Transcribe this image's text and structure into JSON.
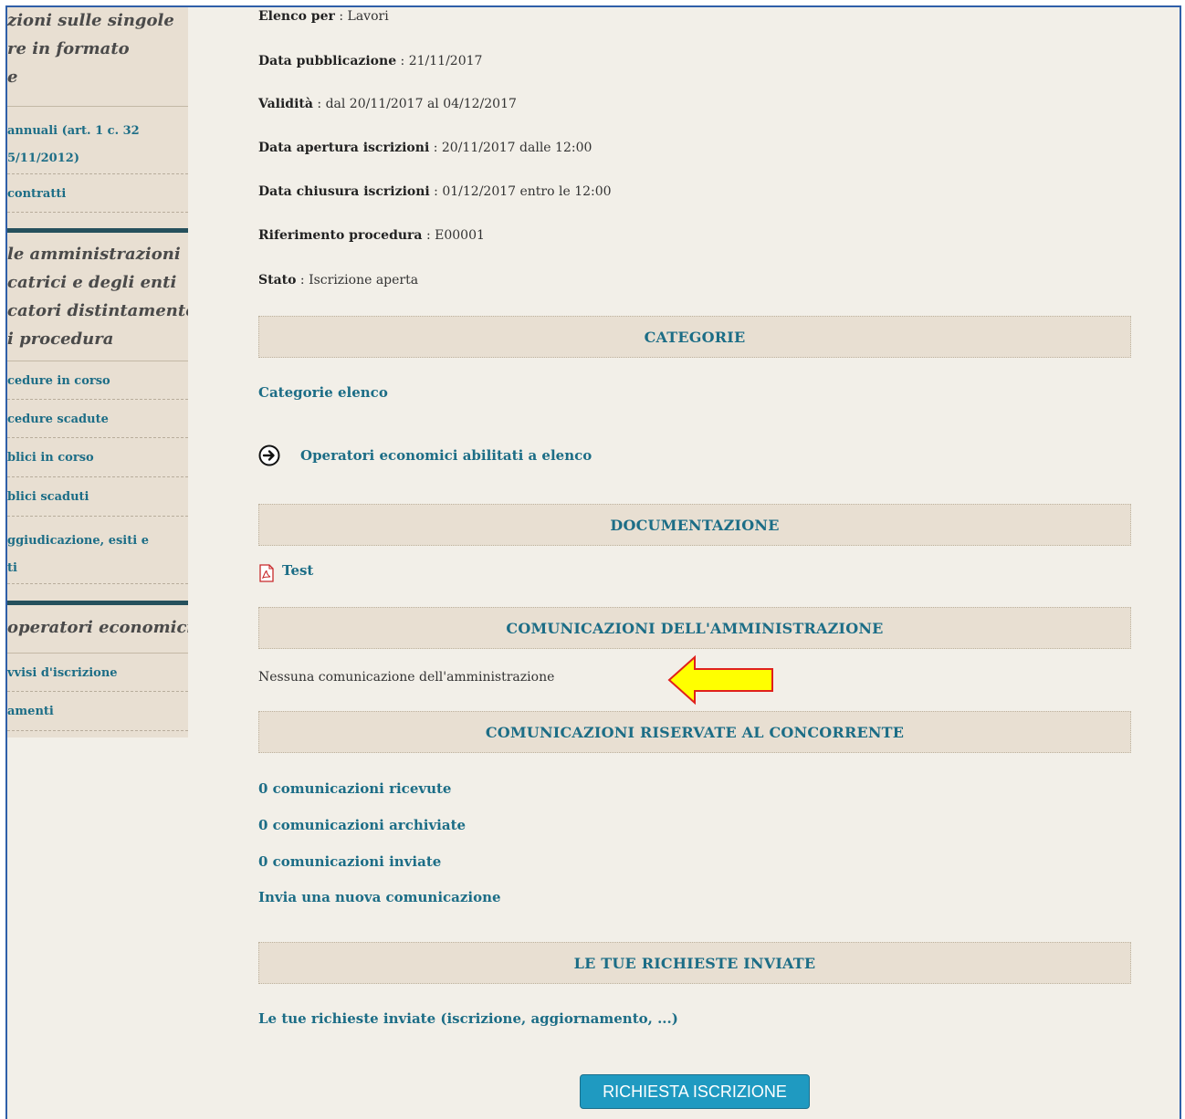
{
  "sidebar": {
    "heading1": [
      "zioni sulle singole",
      "re in formato",
      "e"
    ],
    "links1": [
      [
        "annuali (art. 1 c. 32",
        "5/11/2012)"
      ],
      [
        "contratti"
      ]
    ],
    "heading2": [
      "le amministrazioni",
      "catrici e degli enti",
      "catori distintamente",
      "i procedura"
    ],
    "links2": [
      [
        "cedure in corso"
      ],
      [
        "cedure scadute"
      ],
      [
        "blici in corso"
      ],
      [
        "blici scaduti"
      ],
      [
        "ggiudicazione, esiti e",
        "ti"
      ]
    ],
    "heading3": [
      "operatori economici"
    ],
    "links3": [
      [
        "vvisi d'iscrizione"
      ],
      [
        "amenti"
      ]
    ]
  },
  "details": {
    "elenco_label": "Elenco per",
    "elenco_value": "Lavori",
    "data_pub_label": "Data pubblicazione",
    "data_pub_value": "21/11/2017",
    "validita_label": "Validità",
    "validita_value": "dal 20/11/2017 al 04/12/2017",
    "apertura_label": "Data apertura iscrizioni",
    "apertura_value": "20/11/2017 dalle 12:00",
    "chiusura_label": "Data chiusura iscrizioni",
    "chiusura_value": "01/12/2017 entro le 12:00",
    "riferimento_label": "Riferimento procedura",
    "riferimento_value": "E00001",
    "stato_label": "Stato",
    "stato_value": "Iscrizione aperta"
  },
  "sections": {
    "categorie": "CATEGORIE",
    "documentazione": "DOCUMENTAZIONE",
    "comunicazioni_amm": "COMUNICAZIONI DELL'AMMINISTRAZIONE",
    "comunicazioni_ris": "COMUNICAZIONI RISERVATE AL CONCORRENTE",
    "richieste": "LE TUE RICHIESTE INVIATE"
  },
  "links": {
    "categorie_elenco": "Categorie elenco",
    "operatori": "Operatori economici abilitati a elenco",
    "test_doc": "Test",
    "ricevute": "0 comunicazioni ricevute",
    "archiviate": "0 comunicazioni archiviate",
    "inviate": "0 comunicazioni inviate",
    "nuova": "Invia una nuova comunicazione",
    "richieste_inviate": "Le tue richieste inviate (iscrizione, aggiornamento, ...)"
  },
  "messages": {
    "nessuna_comunicazione": "Nessuna comunicazione dell'amministrazione"
  },
  "button": {
    "richiesta_iscrizione": "RICHIESTA ISCRIZIONE"
  },
  "colors": {
    "link": "#1c6d86",
    "button_bg": "#1f9ac1",
    "arrow_fill": "#ffff00",
    "arrow_stroke": "#e0201c"
  },
  "icons": {
    "arrow_right_circle": "arrow-right-circle-icon",
    "pdf": "pdf-file-icon",
    "annotation_arrow": "annotation-arrow"
  }
}
